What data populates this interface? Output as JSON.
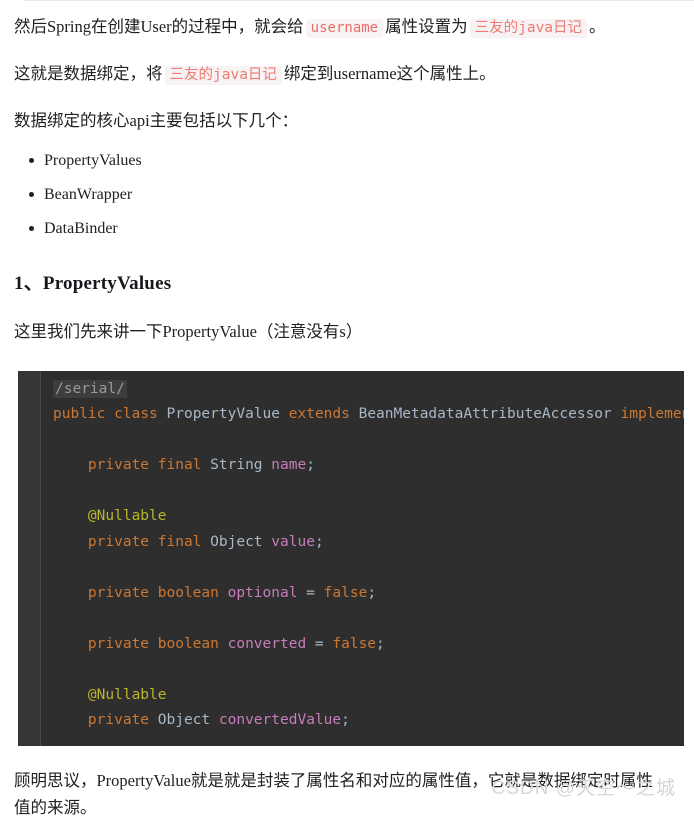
{
  "page": {
    "background": "#ffffff",
    "text_color": "#202124"
  },
  "paragraphs": {
    "p1_part1": "然后Spring在创建User的过程中，就会给",
    "p1_code1": "username",
    "p1_part2": "属性设置为",
    "p1_code2": "三友的java日记",
    "p1_part3": "。",
    "p2_part1": "这就是数据绑定，将",
    "p2_code1": "三友的java日记",
    "p2_part2": "绑定到username这个属性上。",
    "p3": "数据绑定的核心api主要包括以下几个：",
    "pre_code": "这里我们先来讲一下PropertyValue（注意没有s）",
    "after_code": "顾明思议，PropertyValue就是就是封装了属性名和对应的属性值，它就是数据绑定时属性值的来源。"
  },
  "api_list": {
    "items": [
      "PropertyValues",
      "BeanWrapper",
      "DataBinder"
    ]
  },
  "heading": {
    "text": "1、PropertyValues"
  },
  "code_block": {
    "language": "java",
    "theme": "darcula",
    "background": "#2e2e2e",
    "gutter_background": "#363636",
    "colors": {
      "keyword": "#cc7832",
      "type": "#a9b7c6",
      "field": "#c77dbb",
      "annotation": "#bbb529",
      "comment": "#9a9a9a"
    },
    "lines": [
      {
        "tokens": [
          {
            "t": "/serial/",
            "c": "comment"
          }
        ]
      },
      {
        "tokens": [
          {
            "t": "public",
            "c": "keyword"
          },
          {
            "t": " ",
            "c": "plain"
          },
          {
            "t": "class",
            "c": "keyword"
          },
          {
            "t": " ",
            "c": "plain"
          },
          {
            "t": "PropertyValue",
            "c": "type"
          },
          {
            "t": " ",
            "c": "plain"
          },
          {
            "t": "extends",
            "c": "keyword"
          },
          {
            "t": " ",
            "c": "plain"
          },
          {
            "t": "BeanMetadataAttributeAccessor",
            "c": "type"
          },
          {
            "t": " ",
            "c": "plain"
          },
          {
            "t": "implements",
            "c": "keyword"
          }
        ]
      },
      {
        "tokens": []
      },
      {
        "tokens": [
          {
            "t": "    ",
            "c": "plain"
          },
          {
            "t": "private",
            "c": "keyword"
          },
          {
            "t": " ",
            "c": "plain"
          },
          {
            "t": "final",
            "c": "keyword"
          },
          {
            "t": " ",
            "c": "plain"
          },
          {
            "t": "String",
            "c": "type"
          },
          {
            "t": " ",
            "c": "plain"
          },
          {
            "t": "name",
            "c": "field"
          },
          {
            "t": ";",
            "c": "plain"
          }
        ]
      },
      {
        "tokens": []
      },
      {
        "tokens": [
          {
            "t": "    ",
            "c": "plain"
          },
          {
            "t": "@Nullable",
            "c": "annotation"
          }
        ]
      },
      {
        "tokens": [
          {
            "t": "    ",
            "c": "plain"
          },
          {
            "t": "private",
            "c": "keyword"
          },
          {
            "t": " ",
            "c": "plain"
          },
          {
            "t": "final",
            "c": "keyword"
          },
          {
            "t": " ",
            "c": "plain"
          },
          {
            "t": "Object",
            "c": "type"
          },
          {
            "t": " ",
            "c": "plain"
          },
          {
            "t": "value",
            "c": "field"
          },
          {
            "t": ";",
            "c": "plain"
          }
        ]
      },
      {
        "tokens": []
      },
      {
        "tokens": [
          {
            "t": "    ",
            "c": "plain"
          },
          {
            "t": "private",
            "c": "keyword"
          },
          {
            "t": " ",
            "c": "plain"
          },
          {
            "t": "boolean",
            "c": "keyword"
          },
          {
            "t": " ",
            "c": "plain"
          },
          {
            "t": "optional",
            "c": "field"
          },
          {
            "t": " ",
            "c": "plain"
          },
          {
            "t": "=",
            "c": "plain"
          },
          {
            "t": " ",
            "c": "plain"
          },
          {
            "t": "false",
            "c": "keyword"
          },
          {
            "t": ";",
            "c": "plain"
          }
        ]
      },
      {
        "tokens": []
      },
      {
        "tokens": [
          {
            "t": "    ",
            "c": "plain"
          },
          {
            "t": "private",
            "c": "keyword"
          },
          {
            "t": " ",
            "c": "plain"
          },
          {
            "t": "boolean",
            "c": "keyword"
          },
          {
            "t": " ",
            "c": "plain"
          },
          {
            "t": "converted",
            "c": "field"
          },
          {
            "t": " ",
            "c": "plain"
          },
          {
            "t": "=",
            "c": "plain"
          },
          {
            "t": " ",
            "c": "plain"
          },
          {
            "t": "false",
            "c": "keyword"
          },
          {
            "t": ";",
            "c": "plain"
          }
        ]
      },
      {
        "tokens": []
      },
      {
        "tokens": [
          {
            "t": "    ",
            "c": "plain"
          },
          {
            "t": "@Nullable",
            "c": "annotation"
          }
        ]
      },
      {
        "tokens": [
          {
            "t": "    ",
            "c": "plain"
          },
          {
            "t": "private",
            "c": "keyword"
          },
          {
            "t": " ",
            "c": "plain"
          },
          {
            "t": "Object",
            "c": "type"
          },
          {
            "t": " ",
            "c": "plain"
          },
          {
            "t": "convertedValue",
            "c": "field"
          },
          {
            "t": ";",
            "c": "plain"
          }
        ]
      }
    ]
  },
  "watermark": {
    "text": "CSDN @天空～之城"
  }
}
